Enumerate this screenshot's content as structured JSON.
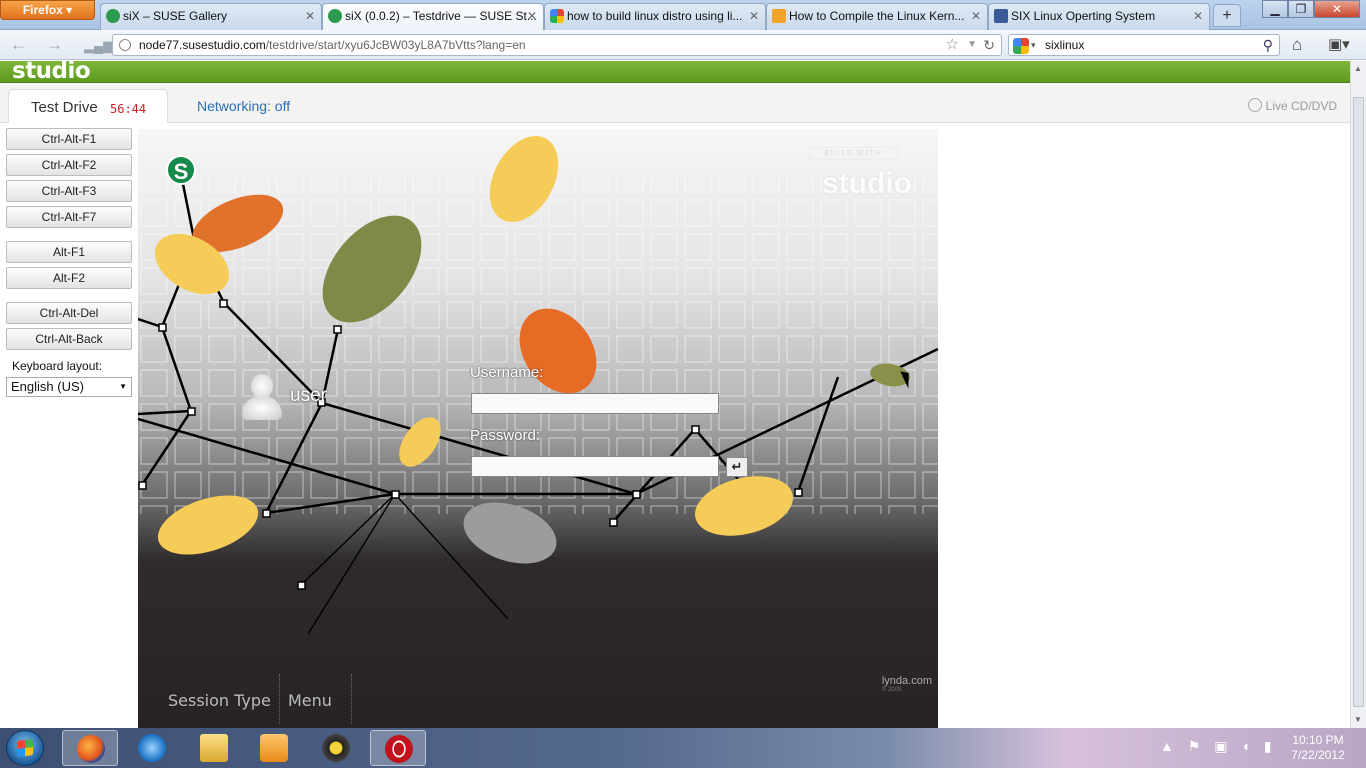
{
  "browser": {
    "menu_button": "Firefox",
    "tabs": [
      {
        "label": "siX – SUSE Gallery",
        "active": false
      },
      {
        "label": "siX (0.0.2) – Testdrive — SUSE St...",
        "active": true
      },
      {
        "label": "how to build linux distro using li...",
        "active": false
      },
      {
        "label": "How to Compile the Linux Kern...",
        "active": false
      },
      {
        "label": "SIX Linux Operting System",
        "active": false
      }
    ],
    "new_tab": "+",
    "url": {
      "host": "node77.susestudio.com",
      "path": "/testdrive/start/xyu6JcBW03yL8A7bVtts?lang=en"
    },
    "search": {
      "value": "sixlinux"
    }
  },
  "studio": {
    "logo": "studio",
    "testdrive": {
      "label": "Test Drive",
      "timer": "56:44"
    },
    "networking": "Networking: off",
    "live_cd": "Live CD/DVD",
    "key_buttons": [
      {
        "label": "Ctrl-Alt-F1"
      },
      {
        "label": "Ctrl-Alt-F2"
      },
      {
        "label": "Ctrl-Alt-F3"
      },
      {
        "label": "Ctrl-Alt-F7"
      },
      {
        "label": "Alt-F1"
      },
      {
        "label": "Alt-F2"
      },
      {
        "label": "Ctrl-Alt-Del"
      },
      {
        "label": "Ctrl-Alt-Back"
      }
    ],
    "keyboard_layout": {
      "label": "Keyboard layout:",
      "value": "English (US)"
    }
  },
  "vm": {
    "logo_letter": "S",
    "built_with": "BUILT WITH",
    "studio_mark": "studio",
    "user_name": "user",
    "username_label": "Username:",
    "password_label": "Password:",
    "enter_glyph": "↵",
    "session_type": "Session Type",
    "menu": "Menu",
    "lynda": "lynda.com",
    "lynda_year": "© 2009"
  },
  "taskbar": {
    "clock_time": "10:10 PM",
    "clock_date": "7/22/2012"
  },
  "colors": {
    "studio_green": "#6aa62a",
    "timer_red": "#cc2222",
    "link_blue": "#2c6fb3",
    "suse_green": "#168a4a",
    "firefox_orange": "#e2711d"
  }
}
